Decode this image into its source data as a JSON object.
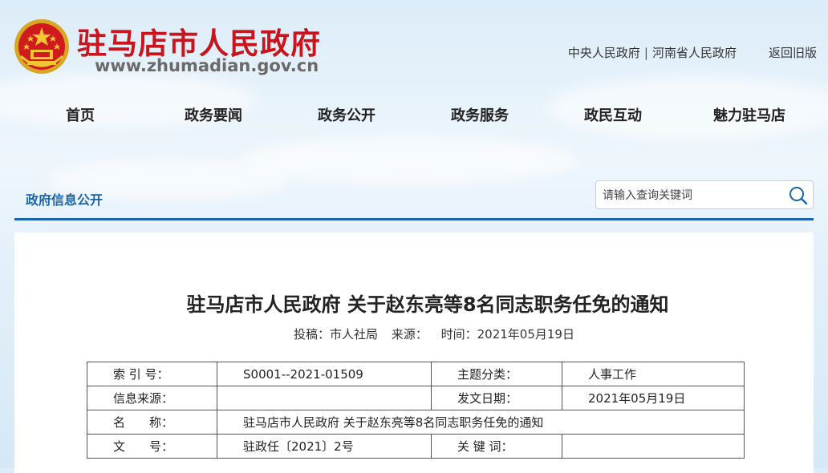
{
  "site": {
    "title": "驻马店市人民政府",
    "url": "www.zhumadian.gov.cn"
  },
  "top_links": {
    "central": "中央人民政府",
    "separator": "|",
    "henan": "河南省人民政府",
    "old_version": "返回旧版"
  },
  "nav": {
    "items": [
      "首页",
      "政务要闻",
      "政务公开",
      "政务服务",
      "政民互动",
      "魅力驻马店"
    ]
  },
  "section": {
    "title": "政府信息公开"
  },
  "search": {
    "placeholder": "请输入查询关键词"
  },
  "article": {
    "title": "驻马店市人民政府 关于赵东亮等8名同志职务任免的通知",
    "meta": {
      "author": "投稿：市人社局",
      "source": "来源：",
      "time": "时间：2021年05月19日"
    },
    "info_table": {
      "index_label": "索 引 号：",
      "index_value": "S0001--2021-01509",
      "topic_label": "主题分类：",
      "topic_value": "人事工作",
      "source_label": "信息来源：",
      "source_value": "",
      "date_label": "发文日期：",
      "date_value": "2021年05月19日",
      "name_label": "名　　称：",
      "name_value": "驻马店市人民政府 关于赵东亮等8名同志职务任免的通知",
      "docno_label": "文　　号：",
      "docno_value": "驻政任〔2021〕2号",
      "keywords_label": "关 键 词：",
      "keywords_value": ""
    }
  },
  "colors": {
    "brand_red": "#c8151d",
    "section_blue": "#1b64ab"
  }
}
